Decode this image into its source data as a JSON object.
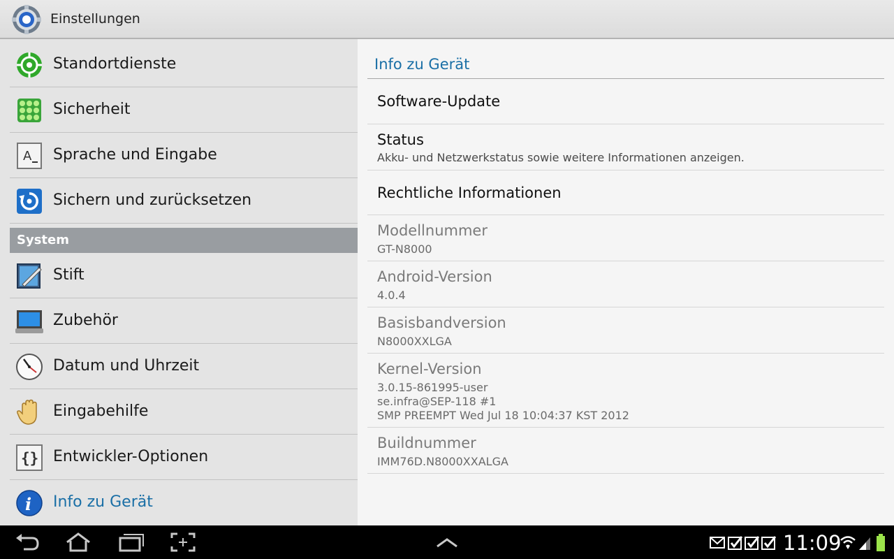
{
  "actionbar": {
    "title": "Einstellungen",
    "icon": "settings-gear-icon"
  },
  "sidebar": {
    "items_top": [
      {
        "label": "Standortdienste",
        "icon": "location-target-icon"
      },
      {
        "label": "Sicherheit",
        "icon": "security-pattern-icon"
      },
      {
        "label": "Sprache und Eingabe",
        "icon": "language-keyboard-icon"
      },
      {
        "label": "Sichern und zurücksetzen",
        "icon": "backup-restore-icon"
      }
    ],
    "section": "System",
    "items_system": [
      {
        "label": "Stift",
        "icon": "pen-tablet-icon"
      },
      {
        "label": "Zubehör",
        "icon": "accessory-dock-icon"
      },
      {
        "label": "Datum und Uhrzeit",
        "icon": "clock-icon"
      },
      {
        "label": "Eingabehilfe",
        "icon": "hand-accessibility-icon"
      },
      {
        "label": "Entwickler-Optionen",
        "icon": "developer-braces-icon"
      },
      {
        "label": "Info zu Gerät",
        "icon": "info-icon",
        "active": true
      }
    ]
  },
  "detail": {
    "title": "Info zu Gerät",
    "software_update": "Software-Update",
    "status_title": "Status",
    "status_summary": "Akku- und Netzwerkstatus sowie weitere Informationen anzeigen.",
    "legal": "Rechtliche Informationen",
    "model_label": "Modellnummer",
    "model_value": "GT-N8000",
    "android_label": "Android-Version",
    "android_value": "4.0.4",
    "baseband_label": "Basisbandversion",
    "baseband_value": "N8000XXLGA",
    "kernel_label": "Kernel-Version",
    "kernel_value": "3.0.15-861995-user\nse.infra@SEP-118 #1\nSMP PREEMPT Wed Jul 18 10:04:37 KST 2012",
    "build_label": "Buildnummer",
    "build_value": "IMM76D.N8000XXALGA"
  },
  "statusbar": {
    "time": "11:09",
    "icons": [
      "email-notification-icon",
      "check-notification-icon",
      "check-notification-icon",
      "check-notification-icon",
      "wifi-icon",
      "signal-icon",
      "battery-icon"
    ],
    "nav": [
      "back-icon",
      "home-icon",
      "recent-apps-icon",
      "screenshot-icon",
      "up-arrow-icon"
    ]
  },
  "colors": {
    "accent": "#1a6fa6",
    "section_header": "#999da1"
  }
}
